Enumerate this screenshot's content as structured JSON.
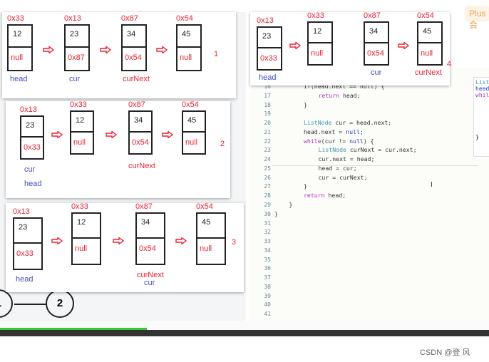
{
  "header": {
    "plus_badge": "Plus 会"
  },
  "editor": {
    "line_numbers": [
      "16",
      "17",
      "18",
      "19",
      "20",
      "21",
      "22",
      "23",
      "24",
      "25",
      "26",
      "27",
      "28",
      "29",
      "30",
      "31",
      "32",
      "33",
      "34",
      "35",
      "36",
      "37",
      "38",
      "39",
      "40",
      "41"
    ],
    "lines": [
      {
        "indent": 2,
        "html": "if(head.next == null) {"
      },
      {
        "indent": 3,
        "kw": "return",
        "rest": " head;"
      },
      {
        "indent": 2,
        "text": "}"
      },
      {
        "indent": 0,
        "text": ""
      },
      {
        "indent": 2,
        "ty": "ListNode",
        "rest": " cur = head.next;"
      },
      {
        "indent": 2,
        "text": "head.next = ",
        "nl": "null",
        "tail": ";"
      },
      {
        "indent": 2,
        "kw": "while",
        "rest": "(cur != ",
        "nl": "null",
        "tail": ") {"
      },
      {
        "indent": 3,
        "ty": "ListNode",
        "rest": " curNext = cur.next;"
      },
      {
        "indent": 3,
        "text": "cur.next = head;"
      },
      {
        "indent": 3,
        "text": "head = cur;"
      },
      {
        "indent": 3,
        "text": "cur = curNext;"
      },
      {
        "indent": 2,
        "text": "}"
      },
      {
        "indent": 2,
        "kw": "return",
        "rest": " head;"
      },
      {
        "indent": 1,
        "text": "}"
      },
      {
        "indent": 0,
        "text": "}"
      }
    ],
    "side_panel": [
      "List",
      "head",
      "whil",
      "}"
    ]
  },
  "diagrams": [
    {
      "step": "1",
      "nodes": [
        {
          "addr": "0x33",
          "value": "12",
          "next": "null"
        },
        {
          "addr": "0x13",
          "value": "23",
          "next": "0x87"
        },
        {
          "addr": "0x87",
          "value": "34",
          "next": "0x54"
        },
        {
          "addr": "0x54",
          "value": "45",
          "next": "null"
        }
      ],
      "labels": [
        {
          "text": "head",
          "color": "blue"
        },
        {
          "text": "cur",
          "color": "blue"
        },
        {
          "text": "curNext",
          "color": "red"
        }
      ]
    },
    {
      "step": "2",
      "nodes": [
        {
          "addr": "0x13",
          "value": "23",
          "next": "0x33"
        },
        {
          "addr": "0x33",
          "value": "12",
          "next": "null"
        },
        {
          "addr": "0x87",
          "value": "34",
          "next": "0x54"
        },
        {
          "addr": "0x54",
          "value": "45",
          "next": "null"
        }
      ],
      "labels": [
        {
          "text": "cur",
          "color": "blue"
        },
        {
          "text": "head",
          "color": "blue"
        },
        {
          "text": "curNext",
          "color": "red"
        }
      ]
    },
    {
      "step": "3",
      "nodes": [
        {
          "addr": "0x13",
          "value": "23",
          "next": "0x33"
        },
        {
          "addr": "0x33",
          "value": "12",
          "next": "null"
        },
        {
          "addr": "0x87",
          "value": "34",
          "next": "0x54"
        },
        {
          "addr": "0x54",
          "value": "45",
          "next": "null"
        }
      ],
      "labels": [
        {
          "text": "head",
          "color": "blue"
        },
        {
          "text": "curNext",
          "color": "red"
        },
        {
          "text": "cur",
          "color": "blue"
        }
      ]
    },
    {
      "step": "4",
      "nodes": [
        {
          "addr": "0x13",
          "value": "23",
          "next": "0x33"
        },
        {
          "addr": "0x33",
          "value": "12",
          "next": "null"
        },
        {
          "addr": "0x87",
          "value": "34",
          "next": "0x54"
        },
        {
          "addr": "0x54",
          "value": "45",
          "next": "null"
        }
      ],
      "labels": [
        {
          "text": "head",
          "color": "blue"
        },
        {
          "text": "cur",
          "color": "blue"
        },
        {
          "text": "curNext",
          "color": "red"
        }
      ]
    }
  ],
  "background_graph": {
    "nodes": [
      "1",
      "2"
    ]
  },
  "video": {
    "progress_percent": 30
  },
  "watermark": "CSDN @登 风",
  "colors": {
    "accent_red": "#e22233",
    "label_blue": "#4650c0",
    "progress_green": "#33cc33"
  }
}
